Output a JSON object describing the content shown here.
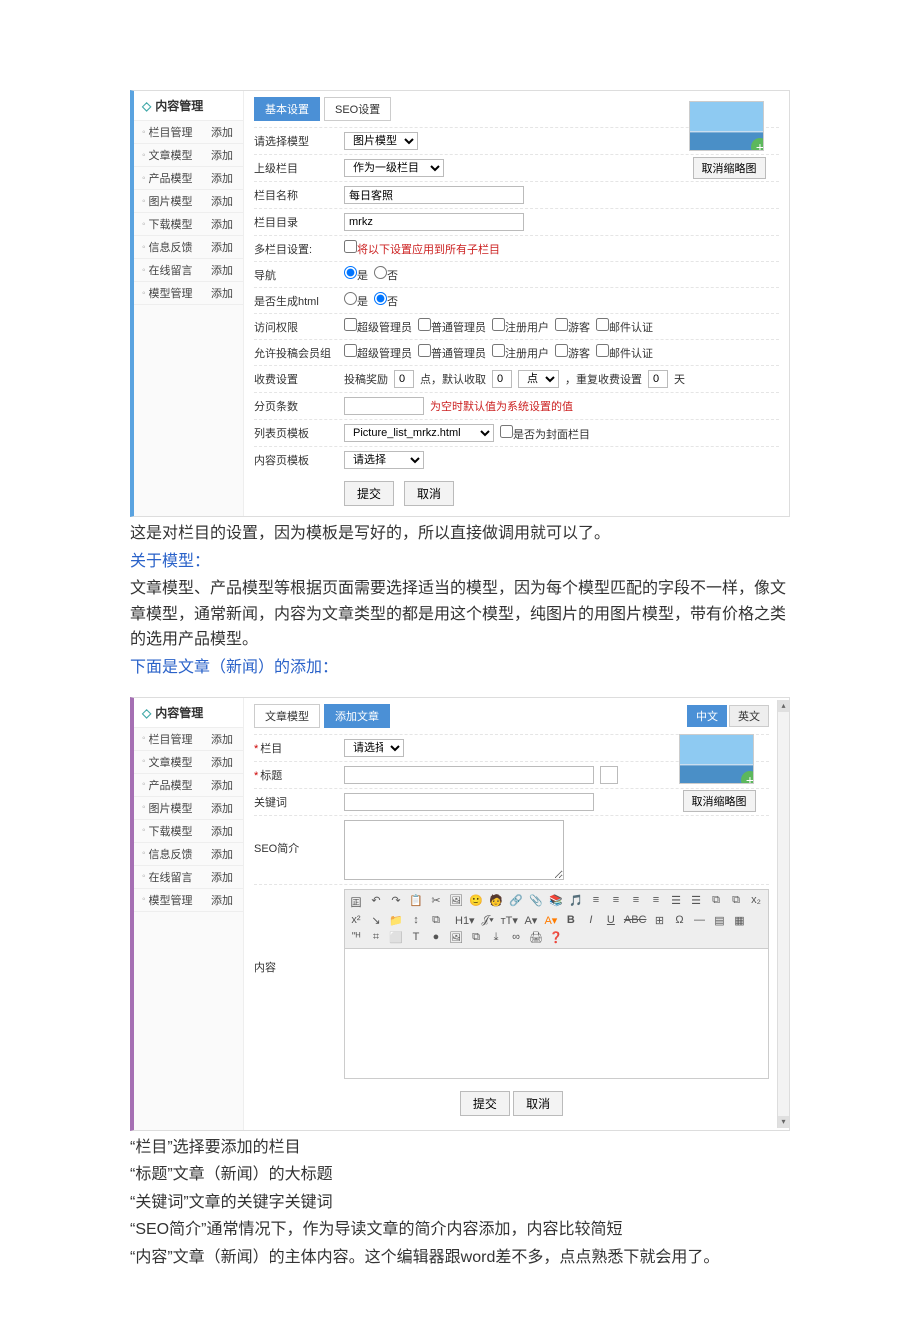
{
  "panel1": {
    "sidebar_title": "内容管理",
    "sidebar": [
      {
        "label": "栏目管理",
        "add": "添加"
      },
      {
        "label": "文章模型",
        "add": "添加"
      },
      {
        "label": "产品模型",
        "add": "添加"
      },
      {
        "label": "图片模型",
        "add": "添加"
      },
      {
        "label": "下载模型",
        "add": "添加"
      },
      {
        "label": "信息反馈",
        "add": "添加"
      },
      {
        "label": "在线留言",
        "add": "添加"
      },
      {
        "label": "模型管理",
        "add": "添加"
      }
    ],
    "tabs": {
      "basic": "基本设置",
      "seo": "SEO设置"
    },
    "rows": {
      "select_model_label": "请选择模型",
      "select_model_value": "图片模型",
      "parent_col_label": "上级栏目",
      "parent_col_value": "作为一级栏目",
      "col_name_label": "栏目名称",
      "col_name_value": "每日客照",
      "col_dir_label": "栏目目录",
      "col_dir_value": "mrkz",
      "multi_label": "多栏目设置:",
      "multi_check": "将以下设置应用到所有子栏目",
      "nav_label": "导航",
      "nav_yes": "是",
      "nav_no": "否",
      "html_label": "是否生成html",
      "html_yes": "是",
      "html_no": "否",
      "access_label": "访问权限",
      "edit_group_label": "允许投稿会员组",
      "perm_opts": [
        "超级管理员",
        "普通管理员",
        "注册用户",
        "游客",
        "邮件认证"
      ],
      "fee_label": "收费设置",
      "fee_reward": "投稿奖励",
      "fee_reward_val": "0",
      "fee_reward_unit": "点，默认收取",
      "fee_take_val": "0",
      "fee_take_unit": "点",
      "fee_repeat": "，重复收费设置",
      "fee_repeat_val": "0",
      "fee_repeat_unit": "天",
      "page_label": "分页条数",
      "page_hint": "为空时默认值为系统设置的值",
      "list_tpl_label": "列表页模板",
      "list_tpl_value": "Picture_list_mrkz.html",
      "list_tpl_cover": "是否为封面栏目",
      "content_tpl_label": "内容页模板",
      "content_tpl_value": "请选择"
    },
    "thumb_cancel": "取消缩略图",
    "submit": "提交",
    "cancel": "取消"
  },
  "desc1": {
    "p1": "这是对栏目的设置，因为模板是写好的，所以直接做调用就可以了。",
    "p2": "关于模型：",
    "p3": "文章模型、产品模型等根据页面需要选择适当的模型，因为每个模型匹配的字段不一样，像文章模型，通常新闻，内容为文章类型的都是用这个模型，纯图片的用图片模型，带有价格之类的选用产品模型。",
    "p4": "下面是文章（新闻）的添加："
  },
  "panel2": {
    "sidebar_title": "内容管理",
    "sidebar": [
      {
        "label": "栏目管理",
        "add": "添加"
      },
      {
        "label": "文章模型",
        "add": "添加"
      },
      {
        "label": "产品模型",
        "add": "添加"
      },
      {
        "label": "图片模型",
        "add": "添加"
      },
      {
        "label": "下载模型",
        "add": "添加"
      },
      {
        "label": "信息反馈",
        "add": "添加"
      },
      {
        "label": "在线留言",
        "add": "添加"
      },
      {
        "label": "模型管理",
        "add": "添加"
      }
    ],
    "tabs": {
      "article_model": "文章模型",
      "add_article": "添加文章",
      "lang_cn": "中文",
      "lang_en": "英文"
    },
    "rows": {
      "col_label": "栏目",
      "col_value": "请选择",
      "title_label": "标题",
      "keyword_label": "关键词",
      "seo_label": "SEO简介",
      "content_label": "内容"
    },
    "editor_toolbar": [
      "囸",
      "↶",
      "↷",
      "|",
      "📋",
      "✂",
      "🖼",
      "🙂",
      "🧑",
      "🔗",
      "📎",
      "📚",
      "🎵",
      "|",
      "≡",
      "≡",
      "≡",
      "≡",
      "☰",
      "☰",
      "⧉",
      "⧉",
      "x₂",
      "x²",
      "|",
      "↘",
      "📁",
      "↕",
      "⧉",
      "H1▾",
      "𝒥▾",
      "тT▾",
      "A▾",
      "A▾",
      "B",
      "I",
      "U",
      "ABC",
      "⊞",
      "Ω",
      "|",
      "—",
      "▤",
      "▦",
      "ʺᴴ",
      "⌗",
      "⬜",
      "T",
      "●",
      "🖼",
      "⧉",
      "⤓",
      "∞",
      "🖨",
      "❓"
    ],
    "thumb_cancel": "取消缩略图",
    "submit": "提交",
    "cancel": "取消"
  },
  "desc2": {
    "p1": "“栏目”选择要添加的栏目",
    "p2": "“标题”文章（新闻）的大标题",
    "p3": "“关键词”文章的关键字关键词",
    "p4": "“SEO简介”通常情况下，作为导读文章的简介内容添加，内容比较简短",
    "p5": "“内容”文章（新闻）的主体内容。这个编辑器跟word差不多，点点熟悉下就会用了。"
  }
}
